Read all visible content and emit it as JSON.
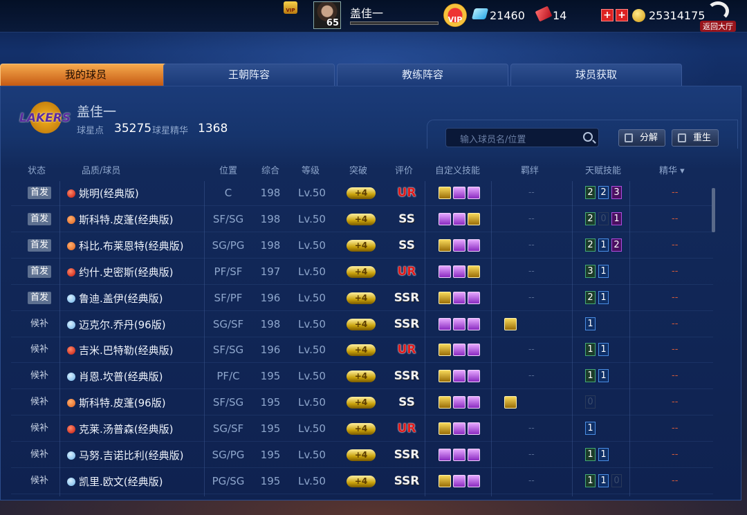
{
  "topbar": {
    "vip_badge": "VIP",
    "player_level": "65",
    "player_name": "盖佳一",
    "vip_label": "VIP",
    "gems": "21460",
    "tickets": "14",
    "plus1": "+",
    "plus2": "+",
    "coins": "25314175",
    "back_label": "返回大厅"
  },
  "tabs": [
    "我的球员",
    "王朝阵容",
    "教练阵容",
    "球员获取"
  ],
  "team": {
    "logo_text": "LAKERS",
    "owner": "盖佳一",
    "points_label": "球星点",
    "points": "35275",
    "essence_label": "球星精华",
    "essence": "1368"
  },
  "toolbar": {
    "search_placeholder": "输入球员名/位置",
    "decompose": "分解",
    "rebirth": "重生"
  },
  "columns": [
    "状态",
    "品质/球员",
    "位置",
    "综合",
    "等级",
    "突破",
    "评价",
    "自定义技能",
    "羁绊",
    "天赋技能",
    "精华 ▾"
  ],
  "players": [
    {
      "status": "首发",
      "starter": true,
      "quality": "red",
      "name": "姚明(经典版)",
      "pos": "C",
      "ovr": "198",
      "lv": "Lv.50",
      "brk": "+4",
      "rank": "UR",
      "skills": [
        "g",
        "p",
        "p"
      ],
      "bond": false,
      "talents": [
        [
          "2",
          "green"
        ],
        [
          "2",
          "blue"
        ],
        [
          "3",
          "purple"
        ]
      ],
      "essence": "--"
    },
    {
      "status": "首发",
      "starter": true,
      "quality": "orange",
      "name": "斯科特.皮蓬(经典版)",
      "pos": "SF/SG",
      "ovr": "198",
      "lv": "Lv.50",
      "brk": "+4",
      "rank": "SS",
      "skills": [
        "p",
        "p",
        "g"
      ],
      "bond": false,
      "talents": [
        [
          "2",
          "green"
        ],
        [
          "0",
          "dim"
        ],
        [
          "1",
          "purple"
        ]
      ],
      "essence": "--"
    },
    {
      "status": "首发",
      "starter": true,
      "quality": "orange",
      "name": "科比.布莱恩特(经典版)",
      "pos": "SG/PG",
      "ovr": "198",
      "lv": "Lv.50",
      "brk": "+4",
      "rank": "SS",
      "skills": [
        "g",
        "p",
        "p"
      ],
      "bond": false,
      "talents": [
        [
          "2",
          "green"
        ],
        [
          "1",
          "blue"
        ],
        [
          "2",
          "purple"
        ]
      ],
      "essence": "--"
    },
    {
      "status": "首发",
      "starter": true,
      "quality": "red",
      "name": "约什.史密斯(经典版)",
      "pos": "PF/SF",
      "ovr": "197",
      "lv": "Lv.50",
      "brk": "+4",
      "rank": "UR",
      "skills": [
        "p",
        "p",
        "g"
      ],
      "bond": false,
      "talents": [
        [
          "3",
          "green"
        ],
        [
          "1",
          "blue"
        ]
      ],
      "essence": "--"
    },
    {
      "status": "首发",
      "starter": true,
      "quality": "blue",
      "name": "鲁迪.盖伊(经典版)",
      "pos": "SF/PF",
      "ovr": "196",
      "lv": "Lv.50",
      "brk": "+4",
      "rank": "SSR",
      "skills": [
        "g",
        "p",
        "p"
      ],
      "bond": false,
      "talents": [
        [
          "2",
          "green"
        ],
        [
          "1",
          "blue"
        ]
      ],
      "essence": "--"
    },
    {
      "status": "候补",
      "starter": false,
      "quality": "blue",
      "name": "迈克尔.乔丹(96版)",
      "pos": "SG/SF",
      "ovr": "198",
      "lv": "Lv.50",
      "brk": "+4",
      "rank": "SSR",
      "skills": [
        "p",
        "p",
        "p"
      ],
      "bond": true,
      "talents": [
        [
          "1",
          "blue"
        ]
      ],
      "essence": "--"
    },
    {
      "status": "候补",
      "starter": false,
      "quality": "red",
      "name": "吉米.巴特勒(经典版)",
      "pos": "SF/SG",
      "ovr": "196",
      "lv": "Lv.50",
      "brk": "+4",
      "rank": "UR",
      "skills": [
        "g",
        "p",
        "p"
      ],
      "bond": false,
      "talents": [
        [
          "1",
          "green"
        ],
        [
          "1",
          "blue"
        ]
      ],
      "essence": "--"
    },
    {
      "status": "候补",
      "starter": false,
      "quality": "blue",
      "name": "肖恩.坎普(经典版)",
      "pos": "PF/C",
      "ovr": "195",
      "lv": "Lv.50",
      "brk": "+4",
      "rank": "SSR",
      "skills": [
        "g",
        "p",
        "p"
      ],
      "bond": false,
      "talents": [
        [
          "1",
          "green"
        ],
        [
          "1",
          "blue"
        ]
      ],
      "essence": "--"
    },
    {
      "status": "候补",
      "starter": false,
      "quality": "orange",
      "name": "斯科特.皮蓬(96版)",
      "pos": "SF/SG",
      "ovr": "195",
      "lv": "Lv.50",
      "brk": "+4",
      "rank": "SS",
      "skills": [
        "g",
        "p",
        "p"
      ],
      "bond": true,
      "talents": [
        [
          "0",
          "dim"
        ]
      ],
      "essence": "--"
    },
    {
      "status": "候补",
      "starter": false,
      "quality": "red",
      "name": "克莱.汤普森(经典版)",
      "pos": "SG/SF",
      "ovr": "195",
      "lv": "Lv.50",
      "brk": "+4",
      "rank": "UR",
      "skills": [
        "g",
        "p",
        "p"
      ],
      "bond": false,
      "talents": [
        [
          "1",
          "blue"
        ]
      ],
      "essence": "--"
    },
    {
      "status": "候补",
      "starter": false,
      "quality": "blue",
      "name": "马努.吉诺比利(经典版)",
      "pos": "SG/PG",
      "ovr": "195",
      "lv": "Lv.50",
      "brk": "+4",
      "rank": "SSR",
      "skills": [
        "p",
        "p",
        "p"
      ],
      "bond": false,
      "talents": [
        [
          "1",
          "green"
        ],
        [
          "1",
          "blue"
        ]
      ],
      "essence": "--"
    },
    {
      "status": "候补",
      "starter": false,
      "quality": "blue",
      "name": "凯里.欧文(经典版)",
      "pos": "PG/SG",
      "ovr": "195",
      "lv": "Lv.50",
      "brk": "+4",
      "rank": "SSR",
      "skills": [
        "g",
        "p",
        "p"
      ],
      "bond": false,
      "talents": [
        [
          "1",
          "green"
        ],
        [
          "1",
          "blue"
        ],
        [
          "0",
          "dim"
        ]
      ],
      "essence": "--"
    }
  ],
  "empty_mark": "--"
}
